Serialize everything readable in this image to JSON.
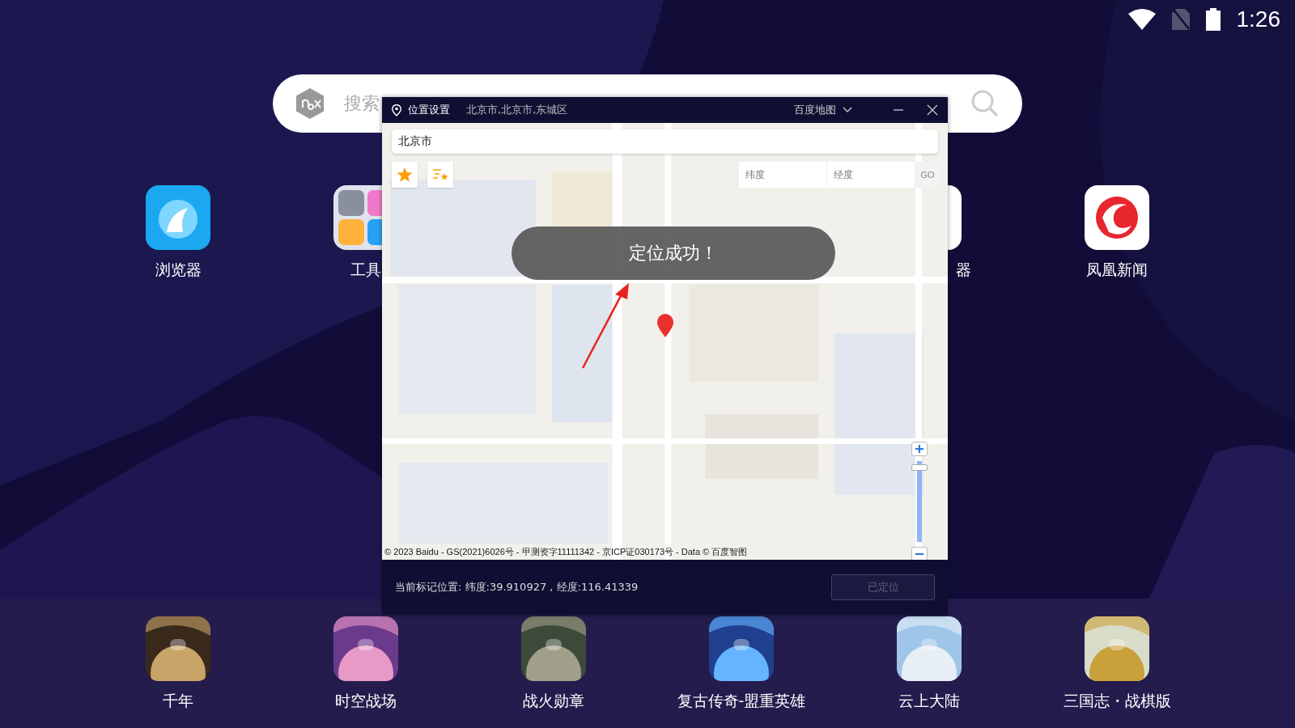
{
  "status_bar": {
    "time": "1:26"
  },
  "search": {
    "placeholder": "搜索"
  },
  "home_apps": [
    {
      "label": "浏览器",
      "kind": "browser"
    },
    {
      "label": "工具",
      "kind": "folder"
    },
    {
      "label": "器",
      "kind": "blue"
    },
    {
      "label": "凤凰新闻",
      "kind": "news"
    }
  ],
  "dock_apps": [
    {
      "label": "千年"
    },
    {
      "label": "时空战场"
    },
    {
      "label": "战火勋章"
    },
    {
      "label": "复古传奇-盟重英雄"
    },
    {
      "label": "云上大陆"
    },
    {
      "label": "三国志・战棋版"
    }
  ],
  "dialog": {
    "title": "位置设置",
    "address": "北京市,北京市,东城区",
    "map_source": "百度地图",
    "search_value": "北京市",
    "lat_placeholder": "纬度",
    "lng_placeholder": "经度",
    "go_label": "GO",
    "toast": "定位成功！",
    "zoom": {
      "level": 0.93
    },
    "copyright": "© 2023 Baidu - GS(2021)6026号 - 甲测资字11111342 - 京ICP证030173号 - Data © 百度智图",
    "current_position": "当前标记位置:  纬度:39.910927 , 经度:116.41339",
    "confirm_button": {
      "label": "已定位",
      "disabled": true
    }
  }
}
